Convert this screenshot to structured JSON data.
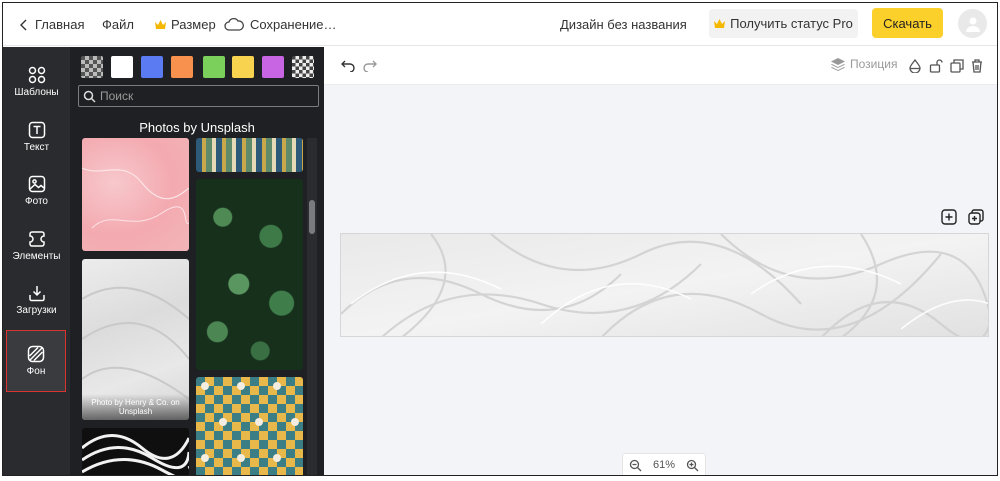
{
  "topbar": {
    "home_label": "Главная",
    "file_label": "Файл",
    "size_label": "Размер",
    "saving_label": "Сохранение…",
    "design_title": "Дизайн без названия",
    "pro_label": "Получить статус Pro",
    "download_label": "Скачать"
  },
  "rail": {
    "items": [
      {
        "label": "Шаблоны",
        "icon": "templates-icon"
      },
      {
        "label": "Текст",
        "icon": "text-icon"
      },
      {
        "label": "Фото",
        "icon": "photo-icon"
      },
      {
        "label": "Элементы",
        "icon": "elements-icon"
      },
      {
        "label": "Загрузки",
        "icon": "uploads-icon"
      },
      {
        "label": "Фон",
        "icon": "background-icon"
      }
    ],
    "active": "Фон"
  },
  "panel": {
    "swatches": [
      "#ffffff",
      "#5b7bf2",
      "#f7914d",
      "#7ad05a",
      "#f8d350",
      "#c765e3"
    ],
    "search_placeholder": "Поиск",
    "section_title": "Photos by Unsplash",
    "photo_caption": "Photo by Henry & Co. on Unsplash"
  },
  "canvas": {
    "position_label": "Позиция",
    "zoom_label": "61%"
  },
  "colors": {
    "accent": "#fcd02b",
    "rail_bg": "#2a2b2e",
    "panel_bg": "#1f2023",
    "active_outline": "#d9352f"
  }
}
